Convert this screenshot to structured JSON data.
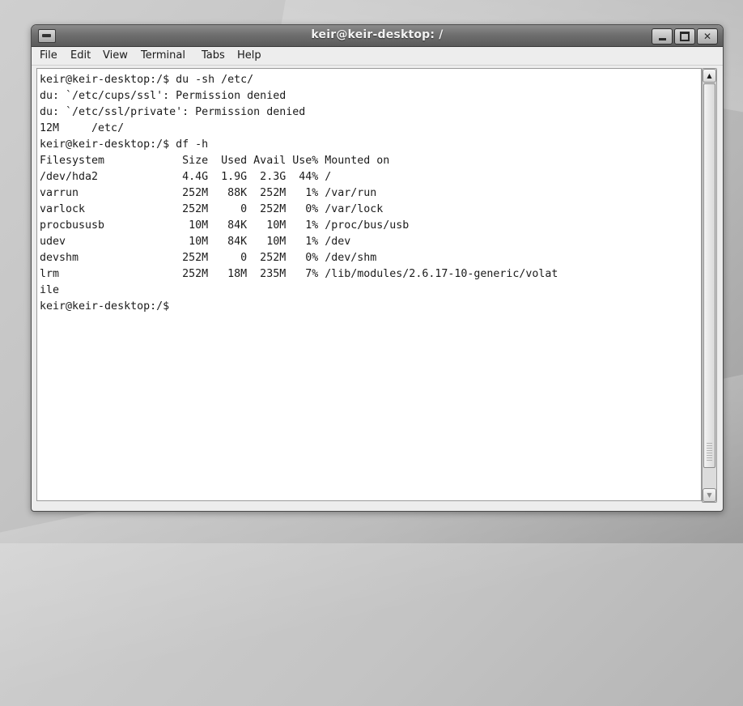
{
  "window": {
    "title": "keir@keir-desktop: /",
    "minimize_glyph": "",
    "maximize_glyph": "",
    "close_glyph": "✕"
  },
  "menubar": {
    "items": [
      {
        "label": "File"
      },
      {
        "label": "Edit"
      },
      {
        "label": "View"
      },
      {
        "label": "Terminal"
      },
      {
        "label": "Tabs"
      },
      {
        "label": "Help"
      }
    ]
  },
  "terminal": {
    "lines": [
      "keir@keir-desktop:/$ du -sh /etc/",
      "du: `/etc/cups/ssl': Permission denied",
      "du: `/etc/ssl/private': Permission denied",
      "12M     /etc/",
      "keir@keir-desktop:/$ df -h",
      "Filesystem            Size  Used Avail Use% Mounted on",
      "/dev/hda2             4.4G  1.9G  2.3G  44% /",
      "varrun                252M   88K  252M   1% /var/run",
      "varlock               252M     0  252M   0% /var/lock",
      "procbususb             10M   84K   10M   1% /proc/bus/usb",
      "udev                   10M   84K   10M   1% /dev",
      "devshm                252M     0  252M   0% /dev/shm",
      "lrm                   252M   18M  235M   7% /lib/modules/2.6.17-10-generic/volat",
      "ile",
      "keir@keir-desktop:/$"
    ]
  },
  "scrollbar": {
    "up_glyph": "▲",
    "down_glyph": "▼"
  }
}
